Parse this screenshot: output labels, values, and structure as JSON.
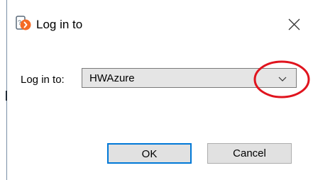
{
  "window": {
    "title": "Log in to",
    "title_icon": "app-login-icon",
    "close_icon": "close-icon"
  },
  "form": {
    "label": "Log in to:",
    "selected_value": "HWAzure",
    "dropdown_icon": "chevron-down-icon"
  },
  "buttons": {
    "ok_label": "OK",
    "cancel_label": "Cancel"
  },
  "annotation": {
    "shape": "ellipse",
    "color": "#e0141e"
  },
  "colors": {
    "accent": "#0078d7",
    "annotation": "#e0141e",
    "icon_orange": "#f46a25"
  }
}
